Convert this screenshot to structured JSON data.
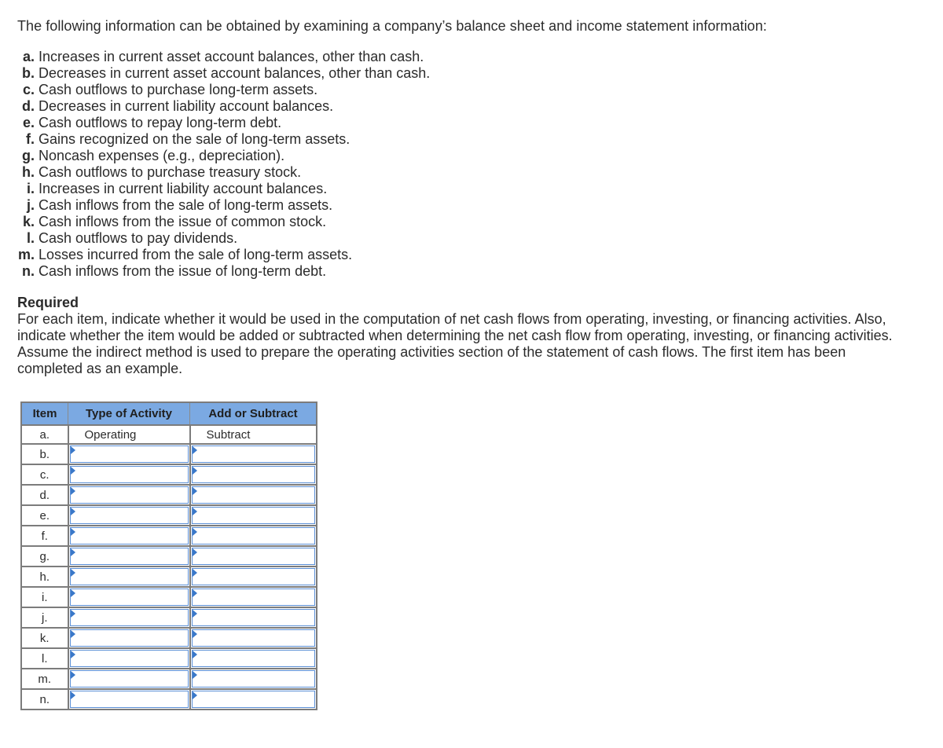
{
  "intro": "The following information can be obtained by examining a company’s balance sheet and income statement information:",
  "items": [
    {
      "label": "a.",
      "text": "Increases in current asset account balances, other than cash."
    },
    {
      "label": "b.",
      "text": "Decreases in current asset account balances, other than cash."
    },
    {
      "label": "c.",
      "text": "Cash outflows to purchase long-term assets."
    },
    {
      "label": "d.",
      "text": "Decreases in current liability account balances."
    },
    {
      "label": "e.",
      "text": "Cash outflows to repay long-term debt."
    },
    {
      "label": "f.",
      "text": "Gains recognized on the sale of long-term assets."
    },
    {
      "label": "g.",
      "text": "Noncash expenses (e.g., depreciation)."
    },
    {
      "label": "h.",
      "text": "Cash outflows to purchase treasury stock."
    },
    {
      "label": "i.",
      "text": "Increases in current liability account balances."
    },
    {
      "label": "j.",
      "text": "Cash inflows from the sale of long-term assets."
    },
    {
      "label": "k.",
      "text": "Cash inflows from the issue of common stock."
    },
    {
      "label": "l.",
      "text": "Cash outflows to pay dividends."
    },
    {
      "label": "m.",
      "text": "Losses incurred from the sale of long-term assets."
    },
    {
      "label": "n.",
      "text": "Cash inflows from the issue of long-term debt."
    }
  ],
  "required": {
    "heading": "Required",
    "body": "For each item, indicate whether it would be used in the computation of net cash flows from operating, investing, or financing activities. Also, indicate whether the item would be added or subtracted when determining the net cash flow from operating, investing, or financing activities. Assume the indirect method is used to prepare the operating activities section of the statement of cash flows. The first item has been completed as an example."
  },
  "table": {
    "headers": {
      "item": "Item",
      "type": "Type of Activity",
      "add": "Add or Subtract"
    },
    "colors": {
      "header_bg": "#7ba9e2",
      "dropdown_border": "#5b8fd6",
      "dropdown_marker": "#3a78c9"
    },
    "example": {
      "item": "a.",
      "type": "Operating",
      "add": "Subtract"
    },
    "rows": [
      {
        "item": "b.",
        "type": "",
        "add": ""
      },
      {
        "item": "c.",
        "type": "",
        "add": ""
      },
      {
        "item": "d.",
        "type": "",
        "add": ""
      },
      {
        "item": "e.",
        "type": "",
        "add": ""
      },
      {
        "item": "f.",
        "type": "",
        "add": ""
      },
      {
        "item": "g.",
        "type": "",
        "add": ""
      },
      {
        "item": "h.",
        "type": "",
        "add": ""
      },
      {
        "item": "i.",
        "type": "",
        "add": ""
      },
      {
        "item": "j.",
        "type": "",
        "add": ""
      },
      {
        "item": "k.",
        "type": "",
        "add": ""
      },
      {
        "item": "l.",
        "type": "",
        "add": ""
      },
      {
        "item": "m.",
        "type": "",
        "add": ""
      },
      {
        "item": "n.",
        "type": "",
        "add": ""
      }
    ]
  }
}
